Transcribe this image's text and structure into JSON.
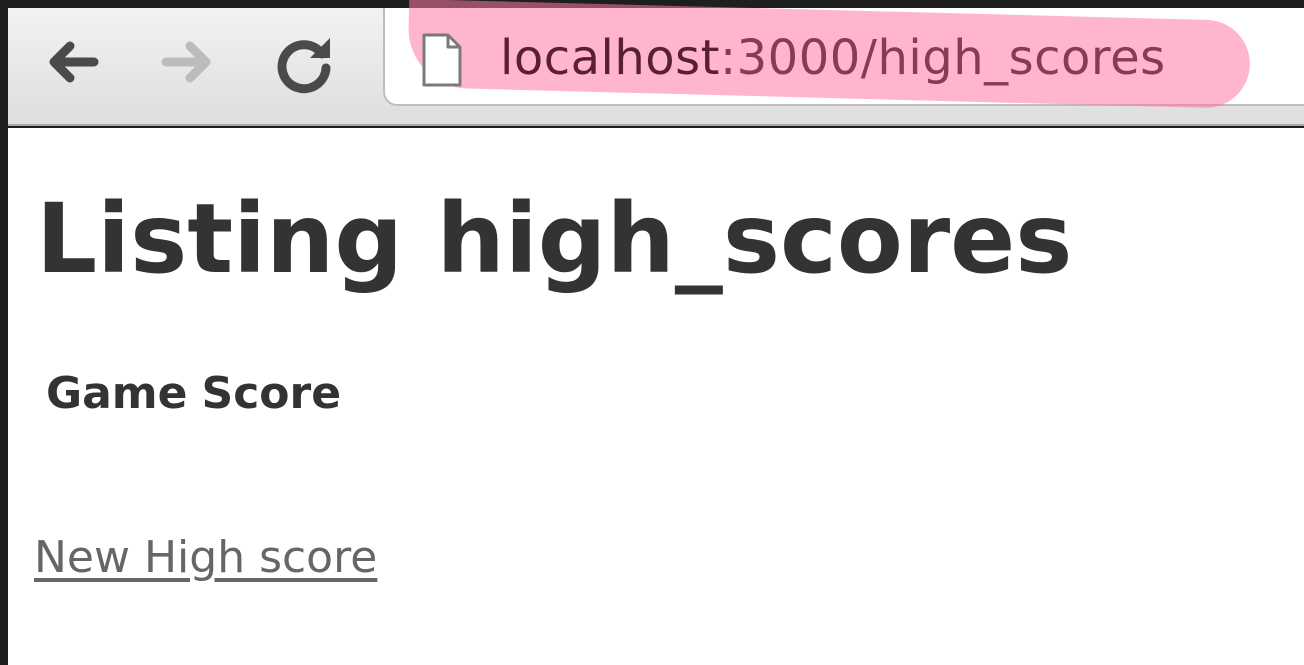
{
  "browser": {
    "url_host": "localhost",
    "url_rest": ":3000/high_scores",
    "back_icon": "arrow-left-icon",
    "forward_icon": "arrow-right-icon",
    "reload_icon": "reload-icon",
    "page_icon": "page-icon",
    "highlight_color": "#ff78aa"
  },
  "page": {
    "title": "Listing high_scores",
    "table": {
      "columns": [
        "Game",
        "Score"
      ]
    },
    "new_link": "New High score"
  }
}
